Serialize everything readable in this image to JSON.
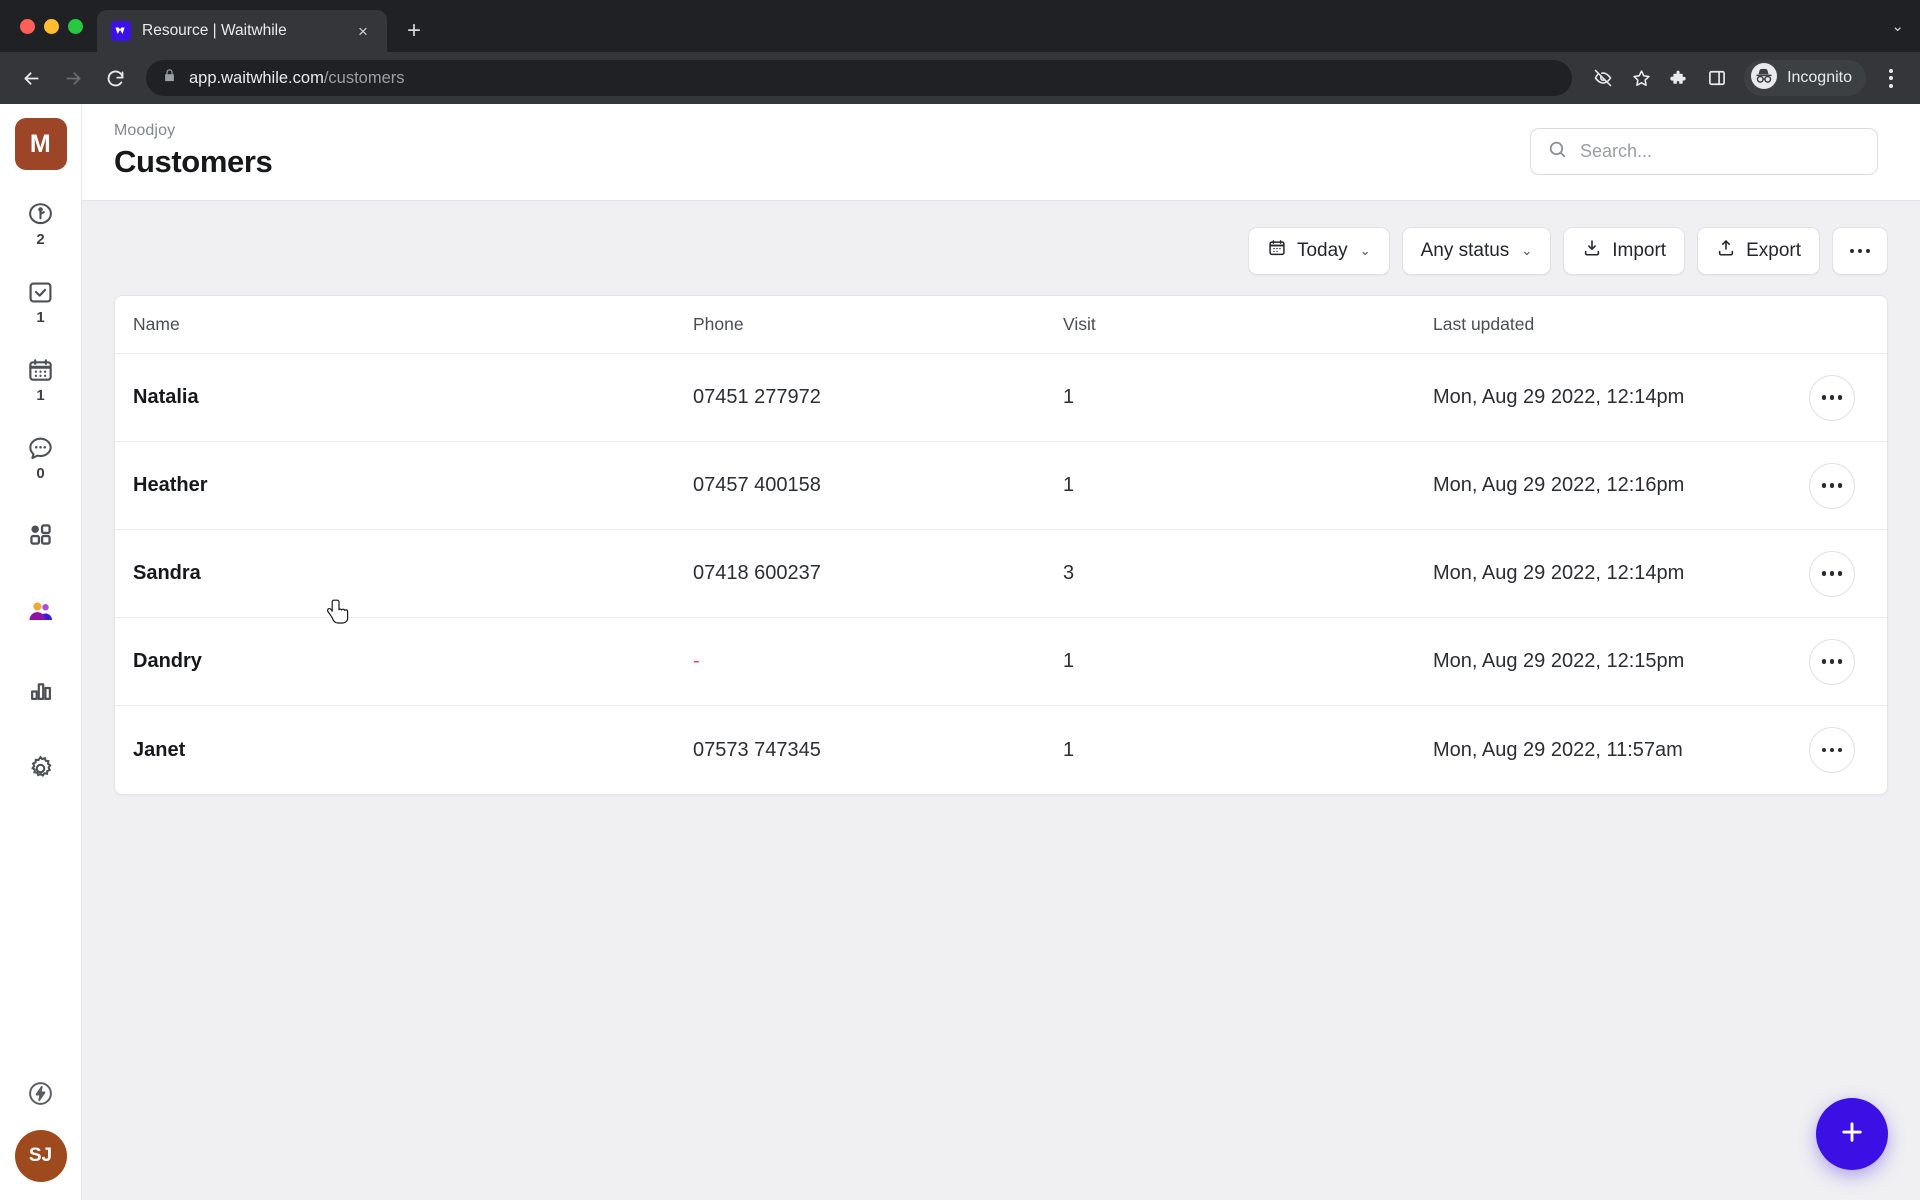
{
  "browser": {
    "tab": {
      "title": "Resource | Waitwhile",
      "favicon": "waitwhile-icon",
      "close_label": "×"
    },
    "new_tab_label": "+",
    "tabstrip_chevron": "⌄",
    "url": {
      "host": "app.waitwhile.com",
      "path": "/customers",
      "lock": "lock-icon"
    },
    "actions": {
      "back": "back-arrow-icon",
      "forward": "forward-arrow-icon",
      "reload": "reload-icon",
      "block_tracking": "eye-off-icon",
      "bookmark": "star-icon",
      "extensions": "puzzle-icon",
      "side_panel": "side-panel-icon",
      "profile": "incognito-icon",
      "profile_label": "Incognito",
      "menu": "kebab-menu-icon"
    }
  },
  "sidebar": {
    "logo": {
      "letter": "M",
      "color": "#9c4527"
    },
    "items": [
      {
        "name": "waitlist",
        "icon": "clock-person-icon",
        "count": "2"
      },
      {
        "name": "checked-in",
        "icon": "check-box-icon",
        "count": "1"
      },
      {
        "name": "bookings",
        "icon": "calendar-icon",
        "count": "1"
      },
      {
        "name": "messages",
        "icon": "chat-bubble-icon",
        "count": "0"
      },
      {
        "name": "services",
        "icon": "grid-blocks-icon",
        "count": ""
      },
      {
        "name": "customers",
        "icon": "people-icon",
        "count": "",
        "active": true
      },
      {
        "name": "analytics",
        "icon": "bar-chart-icon",
        "count": ""
      },
      {
        "name": "settings",
        "icon": "gear-icon",
        "count": ""
      }
    ],
    "bolt": {
      "icon": "bolt-circle-icon"
    },
    "user": {
      "initials": "SJ",
      "color": "#9f4a1e"
    }
  },
  "header": {
    "breadcrumb": "Moodjoy",
    "title": "Customers",
    "search": {
      "placeholder": "Search...",
      "value": "",
      "icon": "search-icon"
    }
  },
  "toolbar": {
    "date_filter": {
      "label": "Today",
      "icon": "calendar-icon",
      "caret": "⌄"
    },
    "status_filter": {
      "label": "Any status",
      "caret": "⌄"
    },
    "import": {
      "label": "Import",
      "icon": "import-download-icon"
    },
    "export": {
      "label": "Export",
      "icon": "export-upload-icon"
    },
    "more": {
      "icon": "ellipsis-icon"
    }
  },
  "table": {
    "columns": [
      "Name",
      "Phone",
      "Visit",
      "Last updated"
    ],
    "rows": [
      {
        "name": "Natalia",
        "phone": "07451 277972",
        "visit": "1",
        "last_updated": "Mon, Aug 29 2022, 12:14pm",
        "phone_empty": false
      },
      {
        "name": "Heather",
        "phone": "07457 400158",
        "visit": "1",
        "last_updated": "Mon, Aug 29 2022, 12:16pm",
        "phone_empty": false
      },
      {
        "name": "Sandra",
        "phone": "07418 600237",
        "visit": "3",
        "last_updated": "Mon, Aug 29 2022, 12:14pm",
        "phone_empty": false
      },
      {
        "name": "Dandry",
        "phone": "-",
        "visit": "1",
        "last_updated": "Mon, Aug 29 2022, 12:15pm",
        "phone_empty": true
      },
      {
        "name": "Janet",
        "phone": "07573 747345",
        "visit": "1",
        "last_updated": "Mon, Aug 29 2022, 11:57am",
        "phone_empty": false
      }
    ],
    "row_menu_icon": "ellipsis-icon"
  },
  "fab": {
    "label": "+",
    "icon": "plus-icon",
    "color": "#3a10e5"
  },
  "colors": {
    "brand_blue": "#3a10e5",
    "logo_brown": "#9c4527",
    "avatar_brown": "#9f4a1e",
    "content_bg": "#f0f0f2",
    "dash_red": "#e0436b"
  }
}
